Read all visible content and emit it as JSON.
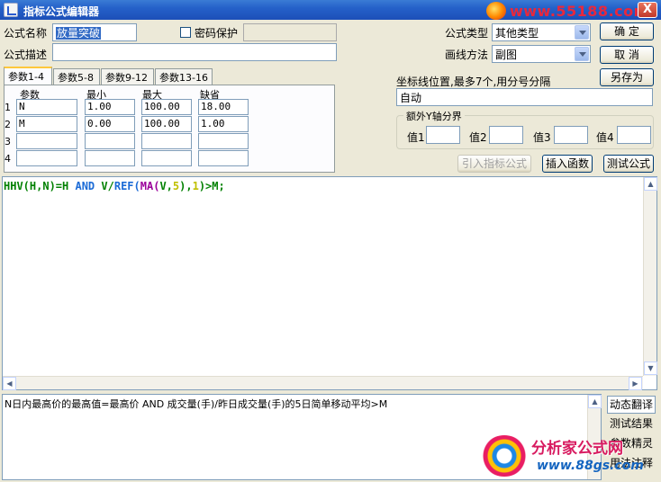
{
  "window": {
    "title": "指标公式编辑器",
    "watermark": "www.55188.com",
    "close_label": "X"
  },
  "formula": {
    "name_label": "公式名称",
    "name_value": "放量突破",
    "password_label": "密码保护",
    "description_label": "公式描述",
    "description_value": ""
  },
  "right_panel": {
    "type_label": "公式类型",
    "type_value": "其他类型",
    "draw_label": "画线方法",
    "draw_value": "副图",
    "ok_label": "确  定",
    "cancel_label": "取  消",
    "saveas_label": "另存为",
    "axis_label": "坐标线位置,最多7个,用分号分隔",
    "axis_value": "自动",
    "extra_y_title": "额外Y轴分界",
    "values": [
      {
        "label": "值1",
        "value": ""
      },
      {
        "label": "值2",
        "value": ""
      },
      {
        "label": "值3",
        "value": ""
      },
      {
        "label": "值4",
        "value": ""
      }
    ],
    "import_label": "引入指标公式",
    "insert_func_label": "插入函数",
    "test_label": "测试公式"
  },
  "params": {
    "tabs": [
      "参数1-4",
      "参数5-8",
      "参数9-12",
      "参数13-16"
    ],
    "headers": [
      "参数",
      "最小",
      "最大",
      "缺省"
    ],
    "rows": [
      {
        "idx": "1",
        "name": "N",
        "min": "1.00",
        "max": "100.00",
        "default": "18.00"
      },
      {
        "idx": "2",
        "name": "M",
        "min": "0.00",
        "max": "100.00",
        "default": "1.00"
      },
      {
        "idx": "3",
        "name": "",
        "min": "",
        "max": "",
        "default": ""
      },
      {
        "idx": "4",
        "name": "",
        "min": "",
        "max": "",
        "default": ""
      }
    ]
  },
  "editor": {
    "tokens": [
      {
        "t": "HHV(H,N)=H ",
        "c": "t"
      },
      {
        "t": "AND",
        "c": "k"
      },
      {
        "t": " V/",
        "c": "t"
      },
      {
        "t": "REF(",
        "c": "k"
      },
      {
        "t": "MA(",
        "c": "m"
      },
      {
        "t": "V,",
        "c": "t"
      },
      {
        "t": "5",
        "c": "n"
      },
      {
        "t": "),",
        "c": "t"
      },
      {
        "t": "1",
        "c": "n"
      },
      {
        "t": ")>M;",
        "c": "t"
      }
    ]
  },
  "bottom": {
    "translation": "N日内最高价的最高值=最高价 AND 成交量(手)/昨日成交量(手)的5日简单移动平均>M",
    "side_buttons": [
      "动态翻译",
      "测试结果",
      "参数精灵",
      "用法注释"
    ],
    "logo_line1": "分析家公式网",
    "logo_line2": "www.88gs.com"
  }
}
